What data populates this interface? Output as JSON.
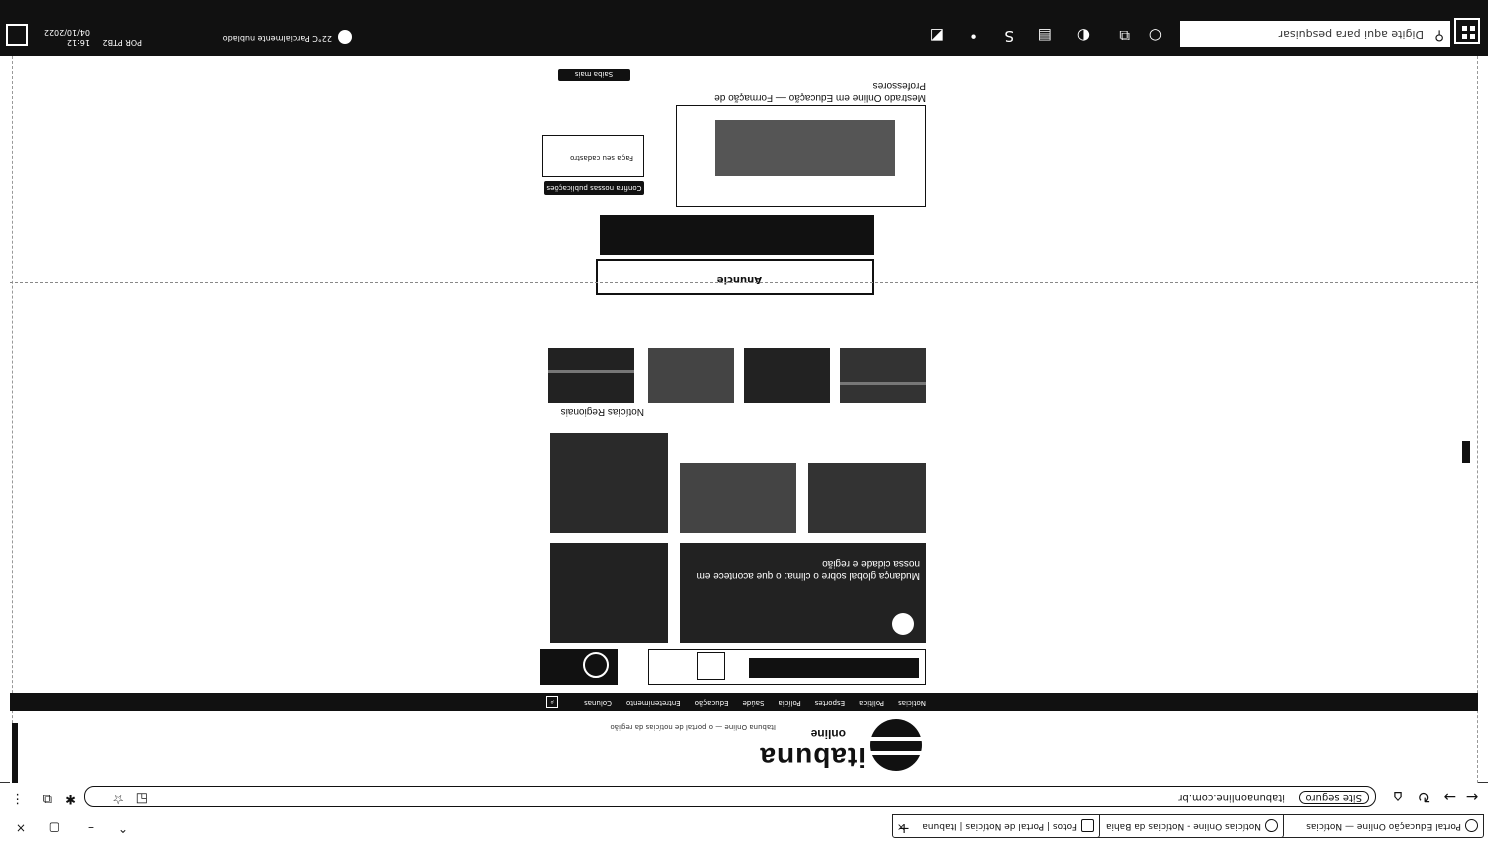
{
  "browser": {
    "tabs": [
      {
        "label": "Portal Educação Online — Notícias",
        "active": true
      },
      {
        "label": "Notícias Online - Notícias da Bahia",
        "active": false
      },
      {
        "label": "Fotos | Portal de Notícias | Itabuna",
        "active": false
      }
    ],
    "new_tab_label": "+",
    "address": {
      "security_chip": "Site seguro",
      "url": "itabunaonline.com.br"
    }
  },
  "site": {
    "brand": "itabuna",
    "brand_sub": "online",
    "tagline": "Itabuna Online — o portal de notícias da região",
    "nav": [
      "Notícias",
      "Política",
      "Esportes",
      "Polícia",
      "Saúde",
      "Educação",
      "Entretenimento",
      "Colunas"
    ],
    "featured_headline": "Mudança global sobre o clima: o que acontece em nossa cidade e região",
    "section_title": "Notícias Regionais",
    "promo_headline": "Mestrado Online em Educação — Formação de Professores",
    "side_button": "Confira nossas publicações",
    "side_sub": "Faça seu cadastro",
    "ad_label": "Anuncie",
    "read_more": "Saiba mais"
  },
  "taskbar": {
    "search_placeholder": "Digite aqui para pesquisar",
    "weather": "22°C Parcialmente nublado",
    "time": "16:12",
    "date": "04/10/2022",
    "lang": "POR PTB2"
  }
}
